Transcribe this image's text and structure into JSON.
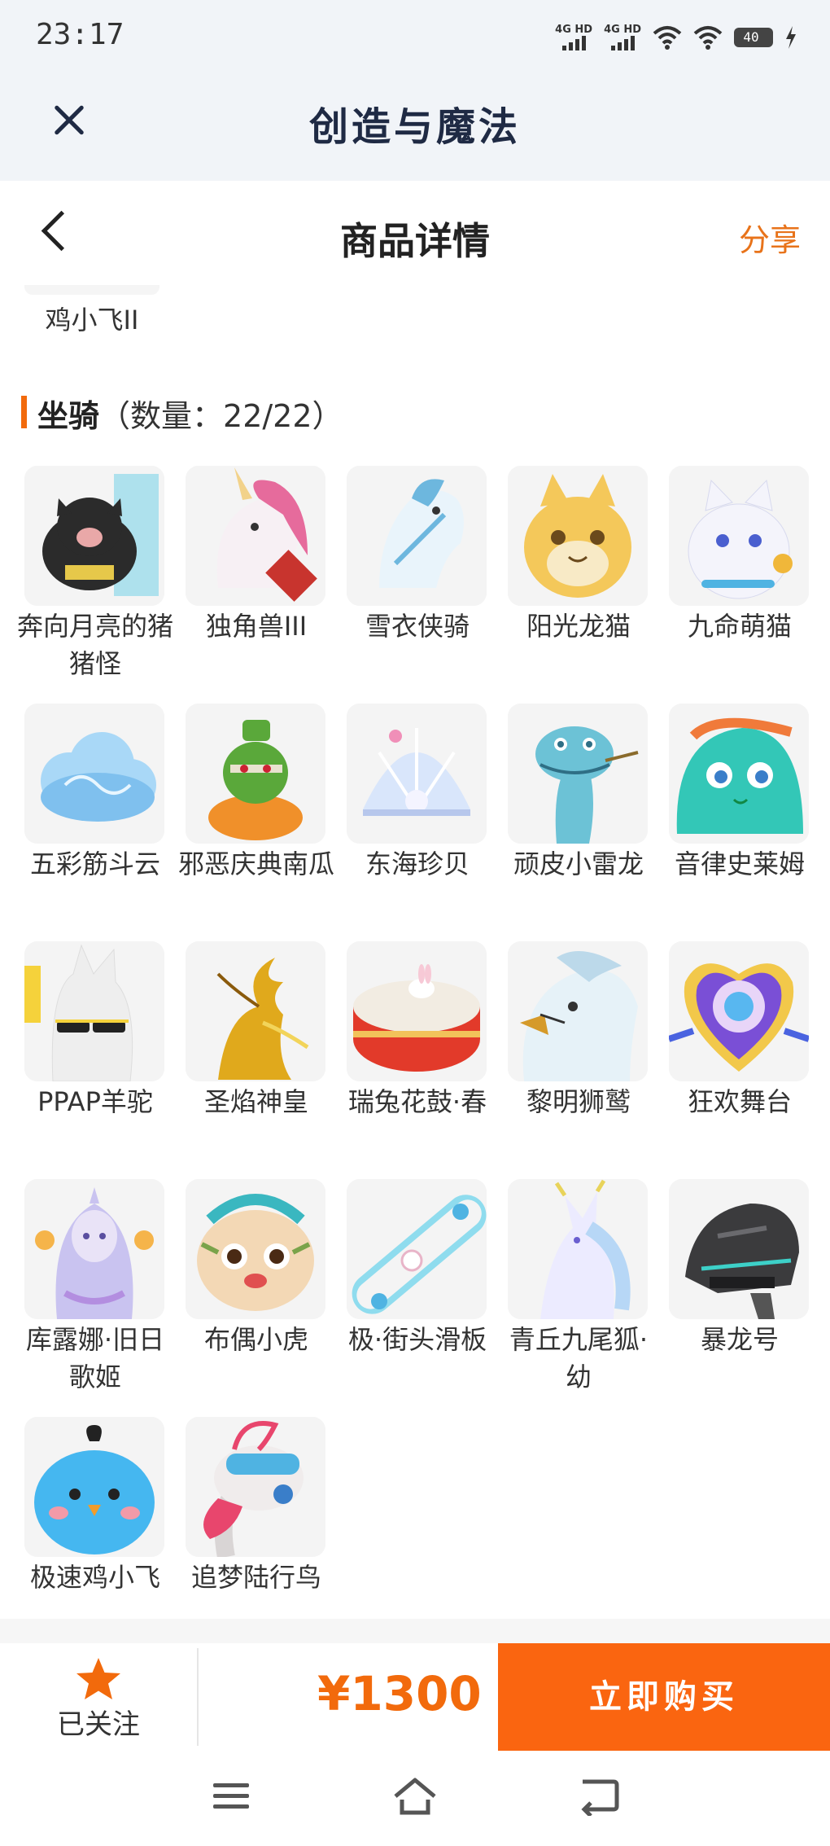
{
  "status_bar": {
    "time": "23:17",
    "network1": "4G HD",
    "network2": "4G HD",
    "battery": "40"
  },
  "app_bar": {
    "title": "创造与魔法"
  },
  "header": {
    "title": "商品详情",
    "share": "分享"
  },
  "prev_item": {
    "label": "鸡小飞II"
  },
  "section": {
    "title": "坐骑",
    "count": "（数量：22/22）"
  },
  "items": [
    {
      "label": "奔向月亮的猪猪怪",
      "art": "pig",
      "color": "#2b2b2b",
      "accent": "#7fd3e8"
    },
    {
      "label": "独角兽III",
      "art": "unicorn",
      "color": "#f7f0f4",
      "accent": "#e66b9c"
    },
    {
      "label": "雪衣侠骑",
      "art": "horse",
      "color": "#e9f4fb",
      "accent": "#6db7de"
    },
    {
      "label": "阳光龙猫",
      "art": "cat",
      "color": "#f4c85a",
      "accent": "#6b4a1c"
    },
    {
      "label": "九命萌猫",
      "art": "whitecat",
      "color": "#f4f4fb",
      "accent": "#f0b73a"
    },
    {
      "label": "五彩筋斗云",
      "art": "cloud",
      "color": "#a9d8f7",
      "accent": "#7fc0ee"
    },
    {
      "label": "邪恶庆典南瓜",
      "art": "pumpkin",
      "color": "#5aa83a",
      "accent": "#f0902a"
    },
    {
      "label": "东海珍贝",
      "art": "shell",
      "color": "#d9e6fb",
      "accent": "#f08fb8"
    },
    {
      "label": "顽皮小雷龙",
      "art": "dragon",
      "color": "#6cc2d6",
      "accent": "#2f6f85"
    },
    {
      "label": "音律史莱姆",
      "art": "slime",
      "color": "#33c7b7",
      "accent": "#f07a3a"
    },
    {
      "label": "PPAP羊驼",
      "art": "alpaca",
      "color": "#eeeeee",
      "accent": "#f5d23b"
    },
    {
      "label": "圣焰神皇",
      "art": "phoenix",
      "color": "#e0a91c",
      "accent": "#8a5a0c"
    },
    {
      "label": "瑞兔花鼓·春",
      "art": "drum",
      "color": "#e23a2a",
      "accent": "#f2c25a"
    },
    {
      "label": "黎明狮鹫",
      "art": "griffin",
      "color": "#e6f2f8",
      "accent": "#d59a2a"
    },
    {
      "label": "狂欢舞台",
      "art": "stage",
      "color": "#7a4fd6",
      "accent": "#f2c84a"
    },
    {
      "label": "库露娜·旧日歌姬",
      "art": "singer",
      "color": "#c9c3f0",
      "accent": "#f5b44a"
    },
    {
      "label": "布偶小虎",
      "art": "tiger",
      "color": "#f3d8b5",
      "accent": "#3ab7c0"
    },
    {
      "label": "极·街头滑板",
      "art": "skateboard",
      "color": "#8fdcee",
      "accent": "#f4f4f4"
    },
    {
      "label": "青丘九尾狐·幼",
      "art": "fox",
      "color": "#ecebff",
      "accent": "#b7d7f6"
    },
    {
      "label": "暴龙号",
      "art": "mecha",
      "color": "#3b3b3d",
      "accent": "#3dd0c8"
    },
    {
      "label": "极速鸡小飞",
      "art": "bird",
      "color": "#45b7f0",
      "accent": "#f29c2a"
    },
    {
      "label": "追梦陆行鸟",
      "art": "ostrich",
      "color": "#f0ecec",
      "accent": "#e8466d"
    }
  ],
  "bottom_bar": {
    "follow_label": "已关注",
    "price": "¥1300",
    "buy_label": "立即购买"
  },
  "colors": {
    "accent": "#f26a0c",
    "buy_button": "#fa6510",
    "share": "#e8731a"
  }
}
